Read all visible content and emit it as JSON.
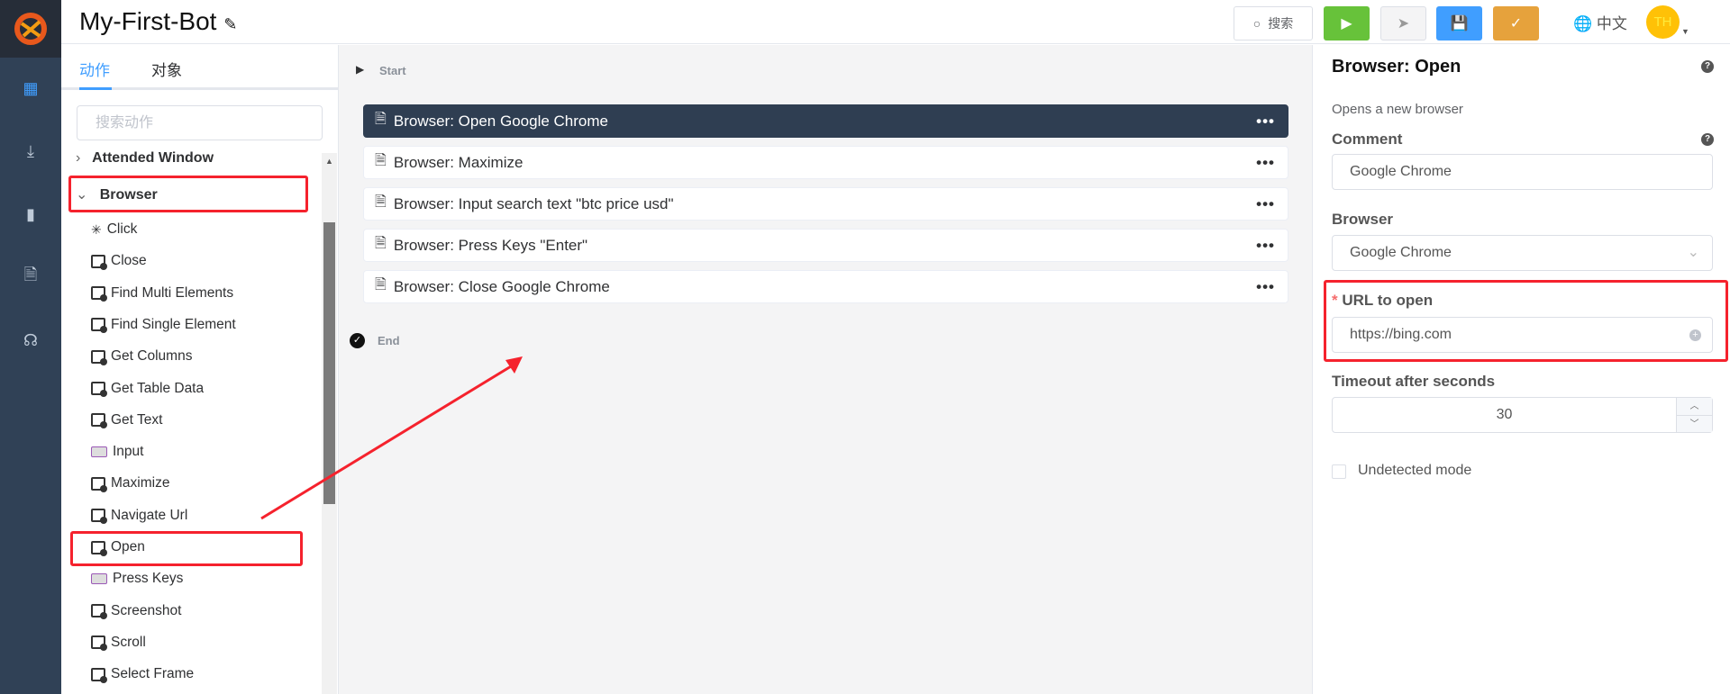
{
  "header": {
    "title": "My-First-Bot",
    "search_label": "搜索",
    "language": "中文",
    "avatar": "TH"
  },
  "colors": {
    "run": "#67c23a",
    "save": "#409eff",
    "check": "#e6a23c",
    "nav": "#304156",
    "selected_step": "#2f3e52",
    "annotation": "#f5222d"
  },
  "nav": {
    "icons": [
      "dashboard-icon",
      "download-icon",
      "chart-icon",
      "document-icon",
      "headset-icon"
    ]
  },
  "left": {
    "tabs": [
      {
        "label": "动作",
        "active": true
      },
      {
        "label": "对象",
        "active": false
      }
    ],
    "search_placeholder": "搜索动作",
    "groups": [
      {
        "label": "Attended Window",
        "expanded": false
      },
      {
        "label": "Browser",
        "expanded": true
      }
    ],
    "items": [
      {
        "label": "Click",
        "icon": "click-icon"
      },
      {
        "label": "Close",
        "icon": "window-icon"
      },
      {
        "label": "Find Multi Elements",
        "icon": "window-icon"
      },
      {
        "label": "Find Single Element",
        "icon": "window-icon"
      },
      {
        "label": "Get Columns",
        "icon": "window-icon"
      },
      {
        "label": "Get Table Data",
        "icon": "window-icon"
      },
      {
        "label": "Get Text",
        "icon": "window-icon"
      },
      {
        "label": "Input",
        "icon": "keyboard-icon"
      },
      {
        "label": "Maximize",
        "icon": "window-icon"
      },
      {
        "label": "Navigate Url",
        "icon": "window-icon"
      },
      {
        "label": "Open",
        "icon": "window-icon"
      },
      {
        "label": "Press Keys",
        "icon": "keyboard-icon"
      },
      {
        "label": "Screenshot",
        "icon": "window-icon"
      },
      {
        "label": "Scroll",
        "icon": "window-icon"
      },
      {
        "label": "Select Frame",
        "icon": "window-icon"
      }
    ]
  },
  "flow": {
    "start": "Start",
    "end": "End",
    "steps": [
      {
        "label": "Browser: Open Google Chrome",
        "selected": true
      },
      {
        "label": "Browser: Maximize"
      },
      {
        "label": "Browser: Input search text \"btc price usd\""
      },
      {
        "label": "Browser: Press Keys \"Enter\""
      },
      {
        "label": "Browser: Close Google Chrome"
      }
    ]
  },
  "props": {
    "title": "Browser: Open",
    "description": "Opens a new browser",
    "comment_label": "Comment",
    "comment_value": "Google Chrome",
    "browser_label": "Browser",
    "browser_value": "Google Chrome",
    "url_label": "URL to open",
    "url_required": "*",
    "url_value": "https://bing.com",
    "timeout_label": "Timeout after seconds",
    "timeout_value": "30",
    "undetected_label": "Undetected mode",
    "undetected_checked": false
  }
}
